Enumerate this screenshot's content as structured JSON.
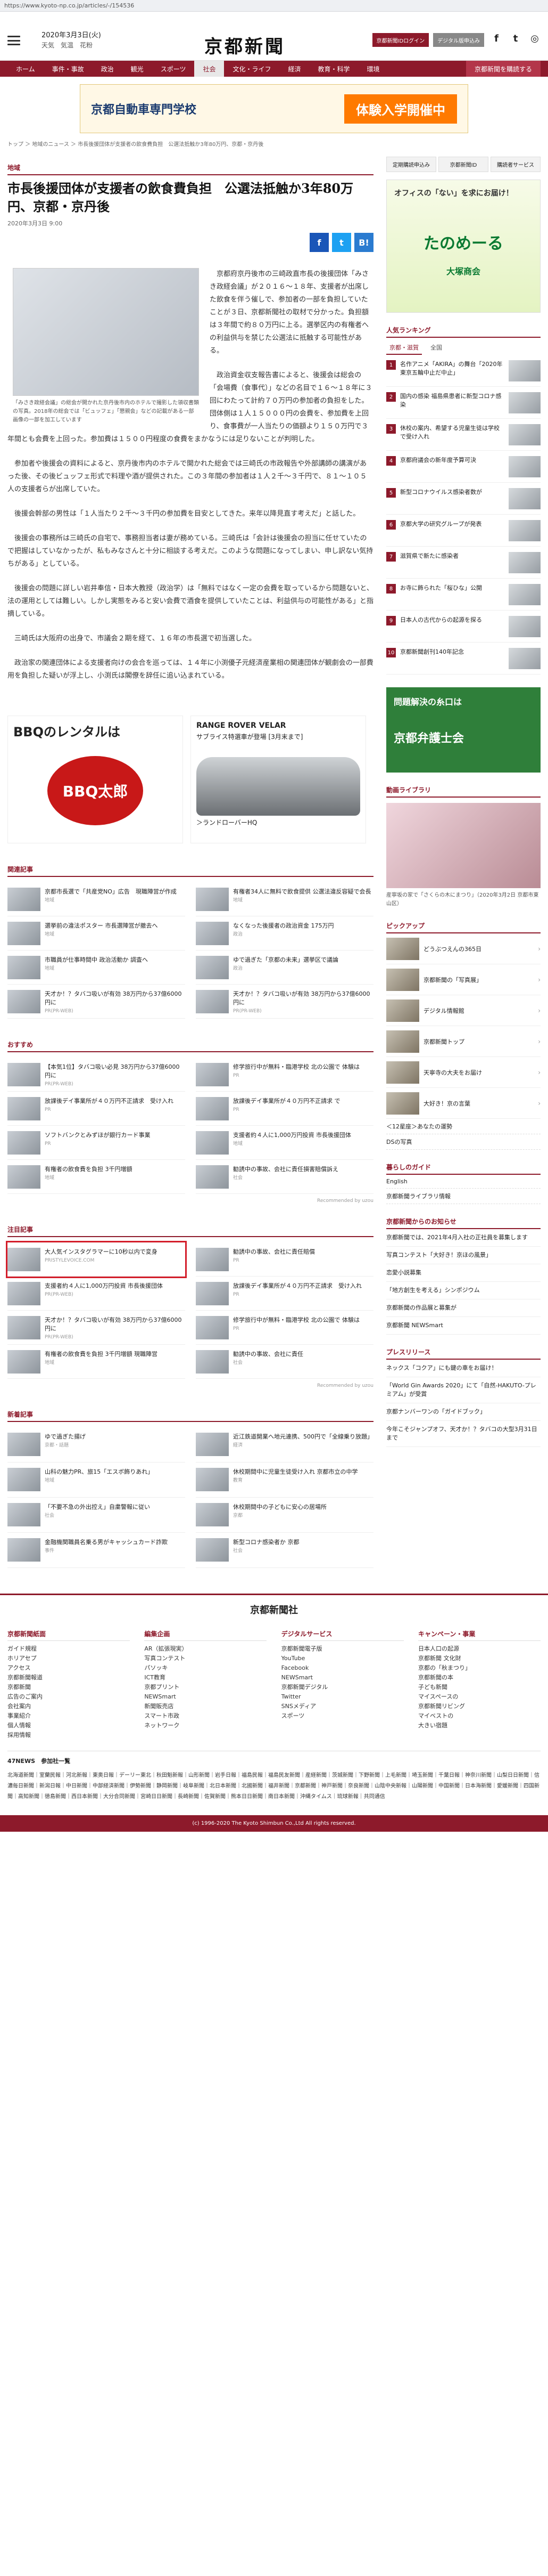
{
  "browser": {
    "url": "https://www.kyoto-np.co.jp/articles/-/154536"
  },
  "header": {
    "date": "2020年3月3日(火)",
    "weather": "天気　気温　花粉",
    "logo": "京都新聞",
    "btn_login": "京都新聞IDログイン",
    "btn_digital": "デジタル版申込み",
    "social": [
      "facebook-icon",
      "twitter-icon",
      "line-icon"
    ]
  },
  "nav": {
    "items": [
      "ホーム",
      "事件・事故",
      "政治",
      "観光",
      "スポーツ",
      "社会",
      "文化・ライフ",
      "経済",
      "教育・科学",
      "環境",
      "京都新聞を購読する"
    ],
    "active_index": 5
  },
  "top_banner": {
    "left": "京都自動車専門学校",
    "right": "体験入学開催中"
  },
  "breadcrumb": "トップ ＞ 地域のニュース ＞ 市長後援団体が支援者の飲食費負担　公選法抵触か3年80万円、京都・京丹後",
  "article": {
    "category": "地域",
    "title": "市長後援団体が支援者の飲食費負担　公選法抵触か3年80万円、京都・京丹後",
    "date": "2020年3月3日 9:00",
    "share": [
      "f",
      "t",
      "B!"
    ],
    "photo_caption": "「みさき政経会議」の総会が開かれた京丹後市内のホテルで撮影した領収書類の写真。2018年の総会では「ビュッフェ」「懇親会」などの記載がある一部画像の一部を加工しています",
    "paragraphs": [
      "京都府京丹後市の三崎政直市長の後援団体「みさき政経会議」が２０１６～１８年、支援者が出席した飲食を伴う催しで、参加者の一部を負担していたことが３日、京都新聞社の取材で分かった。負担額は３年間で約８０万円に上る。選挙区内の有権者への利益供与を禁じた公選法に抵触する可能性がある。",
      "政治資金収支報告書によると、後援会は総会の「会場費（食事代）」などの名目で１６～１８年に３回にわたって計約７０万円の参加者の負担をした。団体側は１人１５０００円の会費を、参加費を上回り、食事費が一人当たりの価額より１５０万円で３年間とも会費を上回った。参加費は１５００円程度の食費をまかなうには足りないことが判明した。",
      "参加者や後援会の資料によると、京丹後市内のホテルで開かれた総会では三崎氏の市政報告や外部講師の講演があった後、その後ビュッフェ形式で料理や酒が提供された。この３年間の参加者は１人２千～３千円で、８１～１０５人の支援者らが出席していた。",
      "後援会幹部の男性は「１人当たり２千～３千円の参加費を目安としてきた。来年以降見直す考えだ」と話した。",
      "後援会の事務所は三崎氏の自宅で、事務担当者は妻が務めている。三崎氏は「会計は後援会の担当に任せていたので把握はしていなかったが、私もみなさんと十分に相談する考えだ。このような問題になってしまい、申し訳ない気持ちがある」としている。",
      "後援会の問題に詳しい岩井奉信・日本大教授（政治学）は「無料ではなく一定の会費を取っているから問題ないと、法の運用としては難しい。しかし実態をみると安い会費で酒食を提供していたことは、利益供与の可能性がある」と指摘している。",
      "三崎氏は大阪府の出身で、市議会２期を経て、１６年の市長選で初当選した。",
      "政治家の関連団体による支援者向けの会合を巡っては、１４年に小渕優子元経済産業相の関連団体が観劇会の一部費用を負担した疑いが浮上し、小渕氏は閣僚を辞任に追い込まれている。"
    ]
  },
  "ads": {
    "bbq_title": "BBQのレンタルは",
    "bbq_logo": "BBQ太郎",
    "rr_title": "RANGE ROVER VELAR",
    "rr_sub": "サブライス特選車が登場 [3月末まで]",
    "rr_link": "＞ランドローバーHQ"
  },
  "related": {
    "title": "関連記事",
    "items": [
      {
        "text": "京都市長選で「共産党NO」広告　現職陣営が作成",
        "meta": "地域"
      },
      {
        "text": "有権者34人に無料で飲食提供 公選法違反容疑で会長",
        "meta": "地域"
      },
      {
        "text": "選挙前の違法ポスター 市長選陣営が撤去へ",
        "meta": "地域"
      },
      {
        "text": "なくなった後援者の政治資金 175万円",
        "meta": "政治"
      },
      {
        "text": "市職員が仕事時間中 政治活動か 調査へ",
        "meta": "地域"
      },
      {
        "text": "ゆで過ぎた「京都の未来」選挙区で議論",
        "meta": "政治"
      },
      {
        "text": "天才か！？タバコ吸いが有効 38万円から37億6000円に",
        "meta": "PR(PR-WEB)"
      },
      {
        "text": "天才か！？タバコ吸いが有効 38万円から37億6000円に",
        "meta": "PR(PR-WEB)"
      }
    ]
  },
  "recommend": {
    "title": "おすすめ",
    "items": [
      {
        "text": "【本気1位】タバコ吸い必見 38万円から37億6000円に",
        "meta": "PR(PR-WEB)"
      },
      {
        "text": "修学旅行中が無料・臨港学校 北の公園で 体験は",
        "meta": "PR"
      },
      {
        "text": "放課後デイ事業所が４０万円不正請求　受け入れ",
        "meta": "PR"
      },
      {
        "text": "放課後デイ事業所が４０万円不正請求 で",
        "meta": "PR"
      },
      {
        "text": "ソフトバンクとみずほが銀行カード事業",
        "meta": "PR"
      },
      {
        "text": "支援者約４人に1,000万円投資 市長後援団体",
        "meta": "地域"
      },
      {
        "text": "有権者の飲食費を負担 3千円増額",
        "meta": "地域"
      },
      {
        "text": "勧誘中の事故、会社に責任損害賠償訴え",
        "meta": "社会"
      }
    ],
    "credit": "Recommended by uzou"
  },
  "attention": {
    "title": "注目記事",
    "items": [
      {
        "text": "大人気インスタグラマーに10秒以内で変身",
        "meta": "PRISTYLEVOICE.COM"
      },
      {
        "text": "勧誘中の事故、会社に責任賠償",
        "meta": "PR"
      },
      {
        "text": "支援者約４人に1,000万円投資 市長後援団体",
        "meta": "PR(PR-WEB)"
      },
      {
        "text": "放課後デイ事業所が４０万円不正請求　受け入れ",
        "meta": "PR"
      },
      {
        "text": "天才か！？タバコ吸いが有効 38万円から37億6000円に",
        "meta": "PR(PR-WEB)"
      },
      {
        "text": "修学旅行中が無料・臨港学校 北の公園で 体験は",
        "meta": "PR"
      },
      {
        "text": "有権者の飲食費を負担 3千円増額 現職陣営",
        "meta": "地域"
      },
      {
        "text": "勧誘中の事故、会社に責任",
        "meta": "社会"
      }
    ],
    "credit": "Recommended by uzou"
  },
  "latest": {
    "title": "新着記事",
    "items": [
      {
        "text": "ゆで過ぎた揚げ",
        "meta": "京都・話題"
      },
      {
        "text": "近江鉄道開業へ地元連携、500円で「全線乗り放題」",
        "meta": "経済"
      },
      {
        "text": "山科の魅力PR、旅15「エスボ飾りあれ」",
        "meta": "地域"
      },
      {
        "text": "休校期間中に児童生徒受け入れ 京都市立の中学",
        "meta": "教育"
      },
      {
        "text": "「不要不急の外出控え」自粛警報に従い",
        "meta": "社会"
      },
      {
        "text": "休校期間中の子どもに安心の居場所",
        "meta": "京都"
      },
      {
        "text": "金融機関職員名乗る男がキャッシュカード詐欺",
        "meta": "事件"
      },
      {
        "text": "新型コロナ感染者か 京都",
        "meta": "社会"
      }
    ]
  },
  "side": {
    "btns": [
      "定期購読申込み",
      "京都新聞ID",
      "購読者サービス"
    ],
    "ad1_top": "オフィスの「ない」を求にお届け！",
    "ad1_brand": "たのめーる",
    "ad1_company": "大塚商会",
    "ranking_title": "人気ランキング",
    "ranking_tabs": [
      "京都・滋賀",
      "全国"
    ],
    "ranking": [
      "名作アニメ「AKIRA」の舞台「2020年東京五輪中止だ中止」",
      "国内の感染 福島県患者に新型コロナ感染",
      "休校の案内、希望する児童生徒は学校で受け入れ",
      "京都府議会の新年度予算可決",
      "新型コロナウイルス感染者数が",
      "京都大学の研究グループが発表",
      "滋賀県で新たに感染者",
      "お寺に飾られた「桜ひな」公開",
      "日本人の古代からの起源を探る",
      "京都新聞創刊140年記念"
    ],
    "ad2_t1": "問題解決の糸口は",
    "ad2_t2": "京都弁護士会",
    "video_title": "動画ライブラリ",
    "video_caption": "産寧坂の家で「さくらの木にまつり」（2020年3月2日 京都市東山区）",
    "pick_title": "ピックアップ",
    "picks": [
      "どうぶつえんの365日",
      "京都新聞の「写真展」",
      "デジタル情報館",
      "京都新聞トップ",
      "天寧寺の大夫をお届け",
      "大好き！京の言葉"
    ],
    "links": [
      "＜12星座＞あなたの運勢",
      "DSの写真"
    ],
    "guide_title": "暮らしのガイド",
    "guide": [
      "English",
      "京都新聞ライブラリ情報"
    ],
    "info_title": "京都新聞からのお知らせ",
    "info": [
      "京都新聞では、2021年4月入社の正社員を募集します",
      "写真コンテスト「大好き！京ほの風景」",
      "恋愛小説募集",
      "「地方創生を考える」シンポジウム",
      "京都新聞の作品展と募集が",
      "京都新聞 NEWSmart"
    ],
    "press_title": "プレスリリース",
    "press": [
      "ネックス「コクア」にも鍵の車をお届け！",
      "「World Gin Awards 2020」にて「自然-HAKUTO-プレミアム」が受賞",
      "京都ナンバーワンの「ガイドブック」",
      "今年こそジャンプオフ、天才か！？タバコの大型3月31日まで"
    ]
  },
  "footer": {
    "logo": "京都新聞社",
    "cols": [
      {
        "title": "京都新聞紙面",
        "items": [
          "ガイド規程",
          "ホリアセプ",
          "アクセス",
          "京都新聞報道",
          "京都新聞",
          "広告のご案内",
          "会社案内",
          "事業紹介",
          "個人情報",
          "採用情報"
        ]
      },
      {
        "title": "編集企画",
        "items": [
          "AR（拡張現実）",
          "写真コンテスト",
          "パソッキ",
          "ICT教育",
          "京都プリント",
          "NEWSmart",
          "新聞販売店",
          "スマート市政",
          "ネットワーク"
        ]
      },
      {
        "title": "デジタルサービス",
        "items": [
          "京都新聞電子版",
          "YouTube",
          "Facebook",
          "NEWSmart",
          "京都新聞デジタル",
          "Twitter",
          "SNSメディア",
          "スポーツ"
        ]
      },
      {
        "title": "キャンペーン・事業",
        "items": [
          "日本人口の起源",
          "京都新聞 文化財",
          "京都の「秋まつり」",
          "京都新聞の本",
          "子ども新聞",
          "マイスペースの",
          "京都新聞リビング",
          "マイベストの",
          "大きい宿題"
        ]
      }
    ],
    "network_title": "47NEWS　参加社一覧",
    "network_list": "北海道新聞｜室蘭民報｜河北新報｜東奥日報｜デーリー東北｜秋田魁新報｜山形新聞｜岩手日報｜福島民報｜福島民友新聞｜産経新聞｜茨城新聞｜下野新聞｜上毛新聞｜埼玉新聞｜千葉日報｜神奈川新聞｜山梨日日新聞｜信濃毎日新聞｜新潟日報｜中日新聞｜中部経済新聞｜伊勢新聞｜静岡新聞｜岐阜新聞｜北日本新聞｜北國新聞｜福井新聞｜京都新聞｜神戸新聞｜奈良新聞｜山陰中央新報｜山陽新聞｜中国新聞｜日本海新聞｜愛媛新聞｜四国新聞｜高知新聞｜徳島新聞｜西日本新聞｜大分合同新聞｜宮崎日日新聞｜長崎新聞｜佐賀新聞｜熊本日日新聞｜南日本新聞｜沖縄タイムス｜琉球新報｜共同通信",
    "copyright": "(c) 1996-2020 The Kyoto Shimbun Co.,Ltd All rights reserved."
  }
}
